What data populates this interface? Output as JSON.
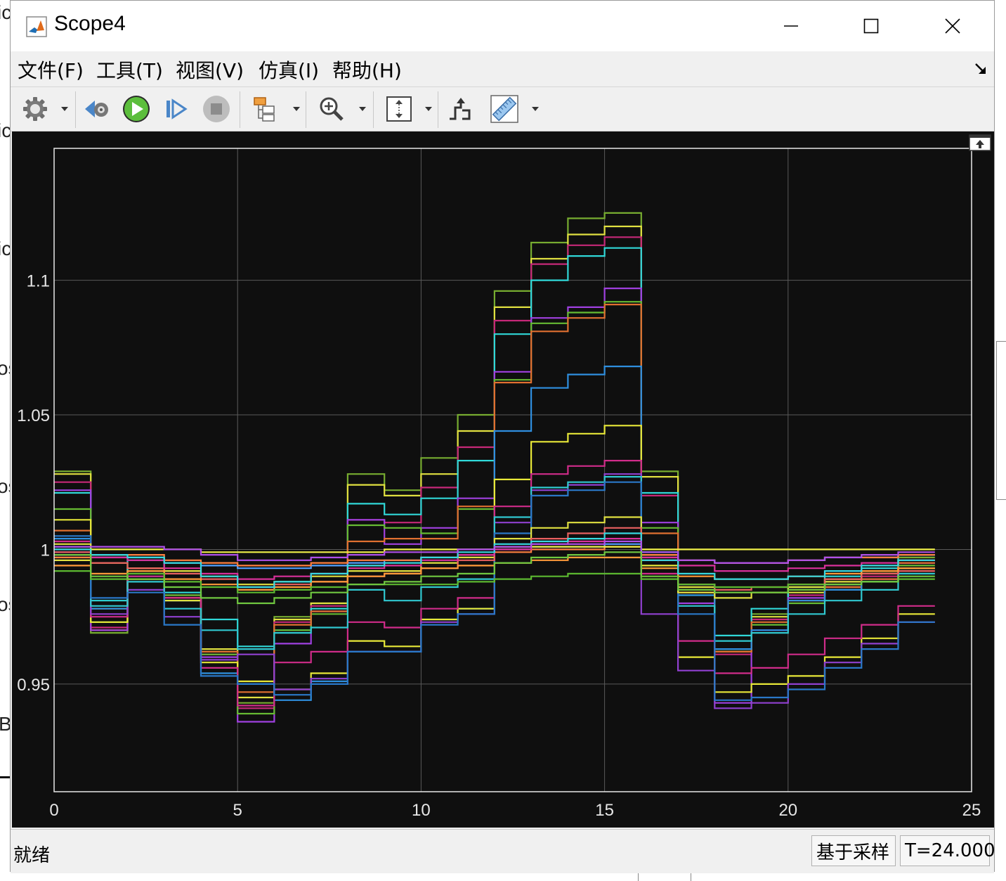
{
  "background_fragments": [
    {
      "text": "ic"
    },
    {
      "text": "ic"
    },
    {
      "text": "ic"
    },
    {
      "text": "os"
    },
    {
      "text": "os"
    },
    {
      "text": "os"
    },
    {
      "text": "B"
    }
  ],
  "window": {
    "title": "Scope4",
    "icon": "matlab-logo-icon",
    "controls": {
      "minimize": "minimize-icon",
      "maximize": "maximize-icon",
      "close": "close-icon"
    }
  },
  "menu": [
    {
      "label": "文件(F)"
    },
    {
      "label": "工具(T)"
    },
    {
      "label": "视图(V)"
    },
    {
      "label": "仿真(I)"
    },
    {
      "label": "帮助(H)"
    }
  ],
  "toolbar": [
    {
      "icon": "gear-icon",
      "dropdown": true
    },
    {
      "icon": "step-back-icon",
      "dropdown": false
    },
    {
      "icon": "run-icon",
      "dropdown": false
    },
    {
      "icon": "step-forward-icon",
      "dropdown": false
    },
    {
      "icon": "stop-icon",
      "dropdown": false
    },
    {
      "icon": "signal-hierarchy-icon",
      "dropdown": true
    },
    {
      "icon": "zoom-in-icon",
      "dropdown": true
    },
    {
      "icon": "autoscale-icon",
      "dropdown": true
    },
    {
      "icon": "triggers-icon",
      "dropdown": false
    },
    {
      "icon": "measurements-icon",
      "dropdown": true
    }
  ],
  "status": {
    "text": "就绪",
    "mode": "基于采样",
    "time": "T=24.000"
  },
  "chart_data": {
    "type": "line",
    "style": "stairs",
    "background": "#000000",
    "axes_color": "#f0f0f0",
    "grid": true,
    "xlim": [
      0,
      25
    ],
    "ylim": [
      0.91,
      1.149
    ],
    "xticks": [
      "0",
      "5",
      "10",
      "15",
      "20",
      "25"
    ],
    "yticks": [
      {
        "value": 0.95,
        "label": "0.95"
      },
      {
        "value": 1,
        "label": "1"
      },
      {
        "value": 1.05,
        "label": "1.05"
      },
      {
        "value": 1.1,
        "label": "1.1"
      }
    ],
    "x": [
      0,
      1,
      2,
      3,
      4,
      5,
      6,
      7,
      8,
      9,
      10,
      11,
      12,
      13,
      14,
      15,
      16,
      17,
      18,
      19,
      20,
      21,
      22,
      23,
      24
    ],
    "series": [
      {
        "color": "#77ac30",
        "values": [
          1.029,
          0.969,
          0.992,
          0.982,
          0.962,
          0.943,
          0.975,
          0.98,
          1.028,
          1.022,
          1.034,
          1.05,
          1.096,
          1.114,
          1.123,
          1.125,
          1.029,
          0.985,
          0.963,
          0.976,
          0.985,
          0.989,
          0.992,
          0.997,
          0.997
        ]
      },
      {
        "color": "#e0e040",
        "values": [
          1.028,
          0.97,
          0.993,
          0.982,
          0.963,
          0.945,
          0.974,
          0.98,
          1.024,
          1.02,
          1.028,
          1.044,
          1.09,
          1.108,
          1.117,
          1.12,
          1.027,
          0.986,
          0.962,
          0.975,
          0.984,
          0.988,
          0.991,
          0.996,
          0.996
        ]
      },
      {
        "color": "#c62878",
        "values": [
          1.025,
          0.971,
          0.993,
          0.983,
          0.961,
          0.941,
          0.973,
          0.979,
          1.011,
          1.01,
          1.023,
          1.038,
          1.085,
          1.106,
          1.113,
          1.116,
          1.02,
          0.984,
          0.961,
          0.974,
          0.983,
          0.987,
          0.99,
          0.995,
          0.995
        ]
      },
      {
        "color": "#30d8d8",
        "values": [
          1.021,
          0.981,
          0.997,
          0.984,
          0.974,
          0.964,
          0.97,
          0.978,
          1.017,
          1.013,
          1.019,
          1.033,
          1.08,
          1.1,
          1.109,
          1.112,
          1.021,
          0.987,
          0.968,
          0.978,
          0.986,
          0.99,
          0.993,
          0.998,
          0.998
        ]
      },
      {
        "color": "#a040e0",
        "values": [
          1.022,
          0.97,
          0.992,
          0.981,
          0.96,
          0.936,
          0.965,
          0.977,
          1.011,
          1.002,
          1.008,
          1.019,
          1.066,
          1.086,
          1.09,
          1.097,
          1.01,
          0.98,
          0.943,
          0.97,
          0.982,
          0.986,
          0.989,
          0.995,
          0.995
        ]
      },
      {
        "color": "#66bb33",
        "values": [
          1.015,
          0.973,
          0.992,
          0.983,
          0.961,
          0.939,
          0.97,
          0.976,
          1.009,
          1.008,
          1.006,
          1.015,
          1.063,
          1.084,
          1.088,
          1.092,
          1.008,
          0.983,
          0.962,
          0.972,
          0.98,
          0.985,
          0.988,
          0.994,
          0.994
        ]
      },
      {
        "color": "#e07030",
        "values": [
          1.007,
          0.978,
          0.989,
          0.982,
          0.962,
          0.947,
          0.972,
          0.977,
          1.003,
          1.004,
          1.004,
          1.016,
          1.062,
          1.081,
          1.086,
          1.091,
          1.006,
          0.984,
          0.962,
          0.973,
          0.981,
          0.986,
          0.989,
          0.995,
          0.995
        ]
      },
      {
        "color": "#2f8fdf",
        "values": [
          1.004,
          0.978,
          0.99,
          0.981,
          0.954,
          0.95,
          0.944,
          0.951,
          0.962,
          0.962,
          0.974,
          0.978,
          1.044,
          1.06,
          1.065,
          1.068,
          0.996,
          0.983,
          0.963,
          0.97,
          0.981,
          0.985,
          0.988,
          0.993,
          0.993
        ]
      },
      {
        "color": "#e8e838",
        "values": [
          1.011,
          0.973,
          0.989,
          0.981,
          0.958,
          0.951,
          0.948,
          0.954,
          0.966,
          0.964,
          0.974,
          0.978,
          1.026,
          1.04,
          1.043,
          1.046,
          0.994,
          0.96,
          0.947,
          0.95,
          0.953,
          0.96,
          0.967,
          0.976,
          0.976
        ]
      },
      {
        "color": "#d02c8a",
        "values": [
          1.003,
          0.975,
          0.99,
          0.982,
          0.956,
          0.942,
          0.958,
          0.962,
          0.973,
          0.971,
          0.978,
          0.982,
          1.016,
          1.028,
          1.031,
          1.033,
          0.991,
          0.966,
          0.954,
          0.956,
          0.961,
          0.967,
          0.972,
          0.979,
          0.979
        ]
      },
      {
        "color": "#9040d0",
        "values": [
          0.999,
          0.976,
          0.985,
          0.975,
          0.959,
          0.961,
          0.948,
          0.952,
          0.962,
          0.962,
          0.973,
          0.976,
          1.01,
          1.022,
          1.024,
          1.028,
          0.976,
          0.955,
          0.941,
          0.943,
          0.95,
          0.958,
          0.965,
          0.973,
          0.973
        ]
      },
      {
        "color": "#30c8d0",
        "values": [
          1.001,
          0.979,
          0.988,
          0.978,
          0.97,
          0.963,
          0.969,
          0.971,
          0.985,
          0.981,
          0.986,
          0.989,
          1.012,
          1.023,
          1.025,
          1.027,
          0.999,
          0.979,
          0.966,
          0.969,
          0.976,
          0.981,
          0.985,
          0.991,
          0.991
        ]
      },
      {
        "color": "#2a78c8",
        "values": [
          1.005,
          0.982,
          0.984,
          0.972,
          0.953,
          0.95,
          0.946,
          0.95,
          0.962,
          0.962,
          0.972,
          0.976,
          1.006,
          1.02,
          1.022,
          1.025,
          0.998,
          0.976,
          0.944,
          0.945,
          0.948,
          0.956,
          0.963,
          0.973,
          0.973
        ]
      },
      {
        "color": "#e0e040",
        "values": [
          1.002,
          0.995,
          0.993,
          0.992,
          0.99,
          0.987,
          0.988,
          0.99,
          0.992,
          0.992,
          0.995,
          0.997,
          1.004,
          1.008,
          1.01,
          1.012,
          0.998,
          0.984,
          0.982,
          0.984,
          0.986,
          0.989,
          0.991,
          0.993,
          0.993
        ]
      },
      {
        "color": "#e86060",
        "values": [
          0.999,
          0.995,
          0.993,
          0.991,
          0.989,
          0.986,
          0.987,
          0.988,
          0.99,
          0.991,
          0.993,
          0.996,
          1.001,
          1.004,
          1.006,
          1.008,
          0.996,
          0.987,
          0.985,
          0.986,
          0.987,
          0.989,
          0.991,
          0.992,
          0.992
        ]
      },
      {
        "color": "#50a0ff",
        "values": [
          0.998,
          0.997,
          0.996,
          0.995,
          0.994,
          0.993,
          0.993,
          0.994,
          0.995,
          0.996,
          0.997,
          0.998,
          1.0,
          1.001,
          1.001,
          1.002,
          0.999,
          0.996,
          0.995,
          0.995,
          0.996,
          0.997,
          0.997,
          0.998,
          0.998
        ]
      },
      {
        "color": "#ff8040",
        "values": [
          0.997,
          0.998,
          0.998,
          0.996,
          0.995,
          0.994,
          0.994,
          0.995,
          0.996,
          0.996,
          0.997,
          0.998,
          0.999,
          1.0,
          1.0,
          1.001,
          0.998,
          0.996,
          0.995,
          0.995,
          0.996,
          0.997,
          0.997,
          0.998,
          0.998
        ]
      },
      {
        "color": "#f0f048",
        "values": [
          0.996,
          1.0,
          1.0,
          1.0,
          0.999,
          0.999,
          0.999,
          0.999,
          0.999,
          1.0,
          1.0,
          1.0,
          1.001,
          1.001,
          1.001,
          1.001,
          1.0,
          1.0,
          1.0,
          1.0,
          1.0,
          1.0,
          1.0,
          1.0,
          1.0
        ]
      },
      {
        "color": "#ff9a3a",
        "values": [
          0.994,
          0.991,
          0.992,
          0.989,
          0.987,
          0.985,
          0.986,
          0.988,
          0.99,
          0.991,
          0.993,
          0.994,
          0.995,
          0.996,
          0.997,
          0.997,
          0.993,
          0.99,
          0.989,
          0.989,
          0.99,
          0.991,
          0.992,
          0.993,
          0.993
        ]
      },
      {
        "color": "#5cb830",
        "values": [
          0.992,
          0.989,
          0.991,
          0.988,
          0.986,
          0.984,
          0.985,
          0.986,
          0.987,
          0.987,
          0.987,
          0.988,
          0.989,
          0.99,
          0.991,
          0.991,
          0.989,
          0.987,
          0.986,
          0.986,
          0.987,
          0.987,
          0.988,
          0.989,
          0.989
        ]
      },
      {
        "color": "#d8309a",
        "values": [
          0.998,
          0.997,
          0.996,
          0.993,
          0.991,
          0.989,
          0.99,
          0.991,
          0.993,
          0.994,
          0.996,
          0.998,
          1.0,
          1.002,
          1.003,
          1.004,
          0.997,
          0.994,
          0.992,
          0.992,
          0.993,
          0.994,
          0.995,
          0.996,
          0.996
        ]
      },
      {
        "color": "#38d8e0",
        "values": [
          1.0,
          0.998,
          0.997,
          0.995,
          0.99,
          0.986,
          0.988,
          0.991,
          0.994,
          0.995,
          0.997,
          0.999,
          1.002,
          1.003,
          1.004,
          1.006,
          0.996,
          0.991,
          0.989,
          0.989,
          0.99,
          0.992,
          0.994,
          0.996,
          0.996
        ]
      },
      {
        "color": "#b050e8",
        "values": [
          1.001,
          1.001,
          1.001,
          1.0,
          0.998,
          0.996,
          0.996,
          0.997,
          0.998,
          0.999,
          0.999,
          1.0,
          1.001,
          1.002,
          1.002,
          1.003,
          0.999,
          0.996,
          0.995,
          0.995,
          0.996,
          0.997,
          0.998,
          0.999,
          0.999
        ]
      },
      {
        "color": "#70c840",
        "values": [
          0.998,
          0.99,
          0.989,
          0.986,
          0.982,
          0.98,
          0.982,
          0.984,
          0.987,
          0.988,
          0.99,
          0.991,
          0.995,
          0.997,
          0.998,
          0.999,
          0.99,
          0.985,
          0.984,
          0.984,
          0.985,
          0.987,
          0.988,
          0.99,
          0.99
        ]
      }
    ]
  }
}
